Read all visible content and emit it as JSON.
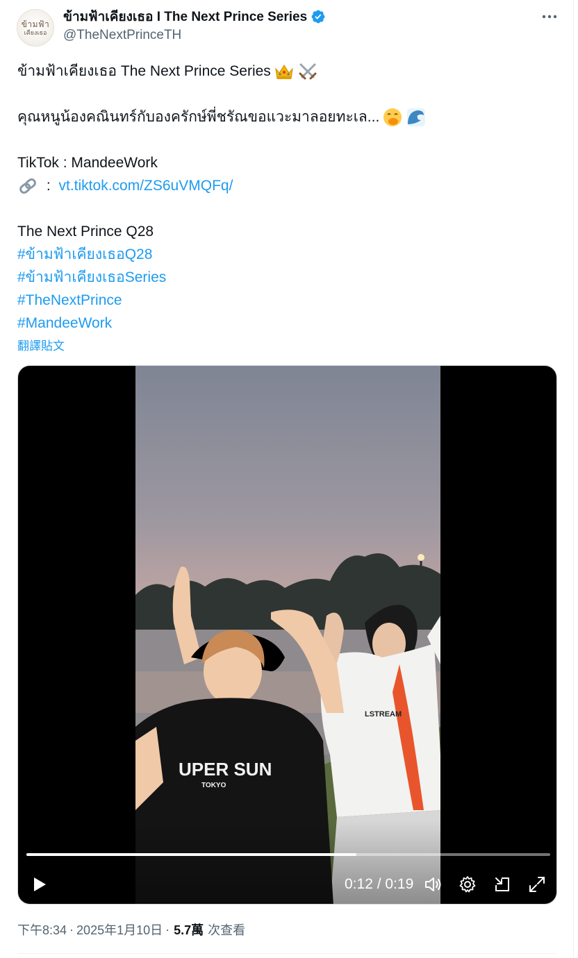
{
  "author": {
    "display_name": "ข้ามฟ้าเคียงเธอ I The Next Prince Series",
    "handle": "@TheNextPrinceTH",
    "avatar_text_1": "ข้ามฟ้า",
    "avatar_text_2": "เคียงเธอ",
    "verified": true
  },
  "tweet": {
    "line1": "ข้ามฟ้าเคียงเธอ The Next Prince Series",
    "line2": "คุณหนูน้องคณินทร์กับองครักษ์พี่ชรัณขอแวะมาลอยทะเล...",
    "tiktok_line": "TikTok : MandeeWork",
    "link_prefix": " : ",
    "link_text": "vt.tiktok.com/ZS6uVMQFq/",
    "q28_line": "The Next Prince Q28",
    "hashtags": [
      "#ข้ามฟ้าเคียงเธอQ28",
      "#ข้ามฟ้าเคียงเธอSeries",
      "#TheNextPrince",
      "#MandeeWork"
    ],
    "emojis": [
      "crown-emoji",
      "crossed-swords-emoji",
      "face-with-hand-over-mouth-emoji",
      "wave-emoji"
    ]
  },
  "translate_label": "翻譯貼文",
  "video": {
    "time_display": "0:12 / 0:19",
    "progress": 0.63,
    "shirt_front": "UPER SUN",
    "shirt_sub": "TOKYO",
    "jersey_text": "LSTREAM"
  },
  "meta": {
    "time": "下午8:34",
    "sep": "·",
    "date": "2025年1月10日",
    "views": "5.7萬",
    "views_label": "次查看"
  },
  "colors": {
    "link": "#1d9bf0",
    "text": "#0f1419",
    "muted": "#536471"
  }
}
